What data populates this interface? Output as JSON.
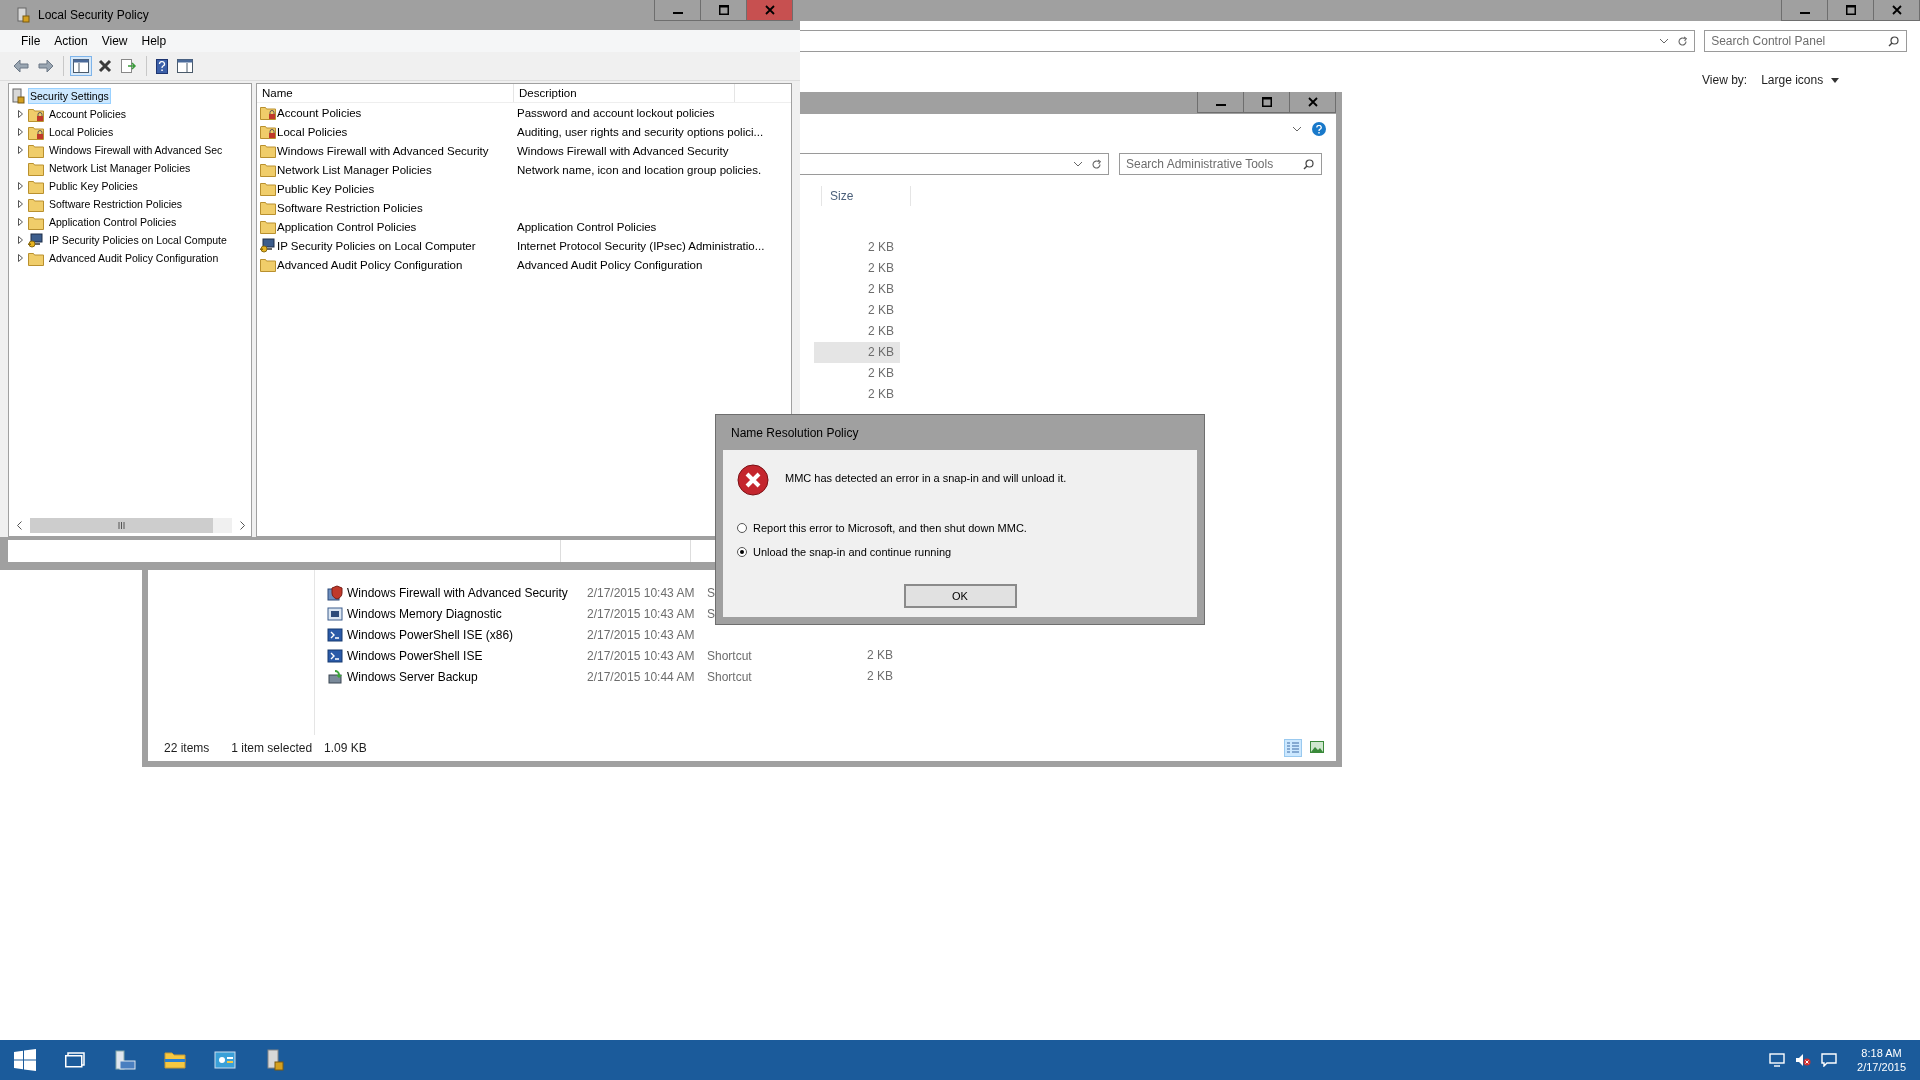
{
  "control_panel": {
    "search": {
      "placeholder": "Search Control Panel"
    },
    "view_by": {
      "label": "View by:",
      "value": "Large icons"
    }
  },
  "admin_tools": {
    "search": {
      "placeholder": "Search Administrative Tools"
    },
    "size_column": "Size",
    "upper_rows": [
      {
        "size": "2 KB",
        "selected": false
      },
      {
        "size": "2 KB",
        "selected": false
      },
      {
        "size": "2 KB",
        "selected": false
      },
      {
        "size": "2 KB",
        "selected": false
      },
      {
        "size": "2 KB",
        "selected": false
      },
      {
        "size": "2 KB",
        "selected": true
      },
      {
        "size": "2 KB",
        "selected": false
      },
      {
        "size": "2 KB",
        "selected": false
      }
    ],
    "lower_rows": [
      {
        "kind": "firewall",
        "name": "Windows Firewall with Advanced Security",
        "date": "2/17/2015 10:43 AM",
        "type": "S"
      },
      {
        "kind": "diagnostic",
        "name": "Windows Memory Diagnostic",
        "date": "2/17/2015 10:43 AM",
        "type": "S"
      },
      {
        "kind": "powershell",
        "name": "Windows PowerShell ISE (x86)",
        "date": "2/17/2015 10:43 AM"
      },
      {
        "kind": "powershell",
        "name": "Windows PowerShell ISE",
        "date": "2/17/2015 10:43 AM",
        "type": "Shortcut",
        "size": "2 KB"
      },
      {
        "kind": "backup",
        "name": "Windows Server Backup",
        "date": "2/17/2015 10:44 AM",
        "type": "Shortcut",
        "size": "2 KB"
      }
    ],
    "status": {
      "count": "22 items",
      "selection": "1 item selected",
      "size": "1.09 KB"
    }
  },
  "security_policy": {
    "window": {
      "title": "Local Security Policy"
    },
    "menu": [
      "File",
      "Action",
      "View",
      "Help"
    ],
    "tree": {
      "label": "Security Settings",
      "selected": true,
      "children": [
        {
          "label": "Account Policies",
          "kind": "secured",
          "expandable": true,
          "selected": false
        },
        {
          "label": "Local Policies",
          "kind": "secured",
          "expandable": true,
          "selected": false
        },
        {
          "label": "Windows Firewall with Advanced Sec",
          "kind": "folder",
          "expandable": true,
          "selected": false
        },
        {
          "label": "Network List Manager Policies",
          "kind": "folder",
          "expandable": false,
          "selected": false
        },
        {
          "label": "Public Key Policies",
          "kind": "folder",
          "expandable": true,
          "selected": false
        },
        {
          "label": "Software Restriction Policies",
          "kind": "folder",
          "expandable": true,
          "selected": false
        },
        {
          "label": "Application Control Policies",
          "kind": "folder",
          "expandable": true,
          "selected": false
        },
        {
          "label": "IP Security Policies on Local Compute",
          "kind": "ipsec",
          "expandable": true,
          "selected": false
        },
        {
          "label": "Advanced Audit Policy Configuration",
          "kind": "folder",
          "expandable": true,
          "selected": false
        }
      ]
    },
    "list": {
      "columns": [
        "Name",
        "Description"
      ],
      "rows": [
        {
          "kind": "secured",
          "name": "Account Policies",
          "description": "Password and account lockout policies"
        },
        {
          "kind": "secured",
          "name": "Local Policies",
          "description": "Auditing, user rights and security options polici..."
        },
        {
          "kind": "folder",
          "name": "Windows Firewall with Advanced Security",
          "description": "Windows Firewall with Advanced Security"
        },
        {
          "kind": "folder",
          "name": "Network List Manager Policies",
          "description": "Network name, icon and location group policies."
        },
        {
          "kind": "folder",
          "name": "Public Key Policies"
        },
        {
          "kind": "folder",
          "name": "Software Restriction Policies"
        },
        {
          "kind": "folder",
          "name": "Application Control Policies",
          "description": "Application Control Policies"
        },
        {
          "kind": "ipsec",
          "name": "IP Security Policies on Local Computer",
          "description": "Internet Protocol Security (IPsec) Administratio..."
        },
        {
          "kind": "folder",
          "name": "Advanced Audit Policy Configuration",
          "description": "Advanced Audit Policy Configuration"
        }
      ]
    }
  },
  "dialog": {
    "title": "Name Resolution Policy",
    "message": "MMC has detected an error in a snap-in and will unload it.",
    "options": [
      {
        "label": "Report this error to Microsoft, and then shut down MMC.",
        "selected": false
      },
      {
        "label": "Unload the snap-in and continue running",
        "selected": true
      }
    ],
    "button": "OK"
  },
  "taskbar": {
    "time": "8:18 AM",
    "date": "2/17/2015"
  }
}
